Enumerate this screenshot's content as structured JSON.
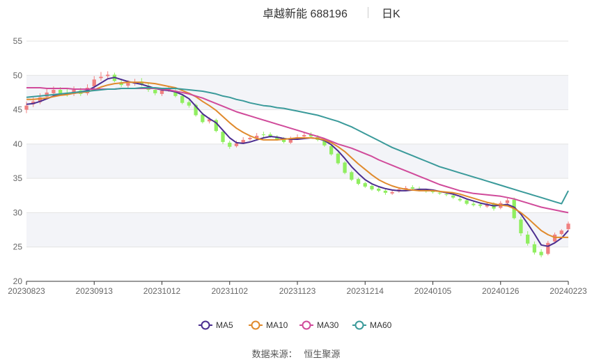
{
  "header": {
    "title": "卓越新能 688196",
    "period": "日K"
  },
  "footer": {
    "source_label": "数据来源：",
    "source_name": "恒生聚源"
  },
  "colors": {
    "up": "#f08080",
    "down": "#90ee60",
    "band": "#f3f4f8",
    "grid": "#e3e3e3",
    "axis": "#333333"
  },
  "chart_data": {
    "type": "candlestick",
    "title": "卓越新能 688196",
    "subtitle": "日K",
    "ylim": [
      20,
      55
    ],
    "yticks": [
      20,
      25,
      30,
      35,
      40,
      45,
      50,
      55
    ],
    "xticks": [
      "20230823",
      "20230913",
      "20231012",
      "20231102",
      "20231123",
      "20231214",
      "20240105",
      "20240126",
      "20240223"
    ],
    "xtick_index": [
      0,
      10,
      20,
      30,
      40,
      50,
      60,
      70,
      80
    ],
    "n_points": 81,
    "legend": [
      {
        "name": "MA5",
        "color": "#4b2d8f"
      },
      {
        "name": "MA10",
        "color": "#e08a2c"
      },
      {
        "name": "MA30",
        "color": "#d04a9a"
      },
      {
        "name": "MA60",
        "color": "#3a9a9a"
      }
    ],
    "close": [
      45.6,
      46.2,
      46.8,
      47.5,
      47.9,
      47.4,
      47.2,
      47.9,
      47.3,
      48.2,
      49.4,
      49.8,
      50.1,
      49.2,
      48.6,
      48.9,
      49.0,
      48.7,
      47.9,
      47.4,
      47.8,
      48.0,
      47.0,
      46.0,
      45.6,
      44.2,
      43.2,
      43.6,
      41.9,
      40.3,
      39.6,
      40.1,
      40.6,
      40.9,
      41.2,
      41.3,
      41.1,
      40.7,
      40.3,
      40.8,
      41.0,
      41.3,
      41.1,
      40.6,
      39.8,
      38.5,
      37.2,
      35.8,
      34.8,
      34.2,
      33.8,
      33.4,
      33.2,
      32.9,
      33.0,
      33.4,
      33.6,
      33.5,
      33.3,
      33.1,
      33.0,
      32.8,
      32.6,
      32.2,
      31.8,
      31.3,
      31.1,
      31.0,
      31.2,
      30.6,
      31.4,
      31.8,
      29.2,
      27.0,
      25.5,
      24.2,
      23.8,
      25.6,
      26.8,
      27.4,
      28.4
    ],
    "open": [
      45.0,
      45.8,
      46.1,
      46.9,
      47.4,
      47.9,
      47.5,
      47.3,
      47.8,
      47.4,
      48.4,
      49.6,
      49.9,
      50.1,
      49.0,
      48.5,
      48.8,
      49.1,
      48.5,
      47.9,
      47.3,
      47.9,
      47.8,
      47.0,
      46.1,
      45.7,
      44.3,
      43.3,
      43.5,
      41.8,
      40.2,
      39.7,
      40.2,
      40.7,
      40.8,
      41.4,
      41.4,
      41.0,
      40.8,
      40.2,
      40.9,
      41.1,
      41.4,
      41.0,
      40.6,
      39.7,
      38.6,
      37.3,
      35.9,
      34.9,
      34.3,
      33.9,
      33.5,
      33.2,
      32.8,
      33.1,
      33.4,
      33.7,
      33.5,
      33.3,
      33.2,
      32.9,
      32.7,
      32.5,
      32.0,
      31.8,
      31.3,
      31.2,
      30.9,
      31.3,
      30.7,
      31.4,
      31.9,
      29.0,
      26.8,
      25.4,
      24.3,
      24.0,
      25.8,
      26.9,
      27.6
    ],
    "high": [
      46.2,
      46.8,
      47.4,
      48.0,
      48.4,
      48.3,
      48.0,
      48.4,
      48.2,
      48.7,
      49.9,
      50.5,
      50.6,
      50.4,
      49.5,
      49.3,
      49.5,
      49.6,
      48.9,
      48.2,
      48.2,
      48.5,
      48.1,
      47.3,
      46.4,
      45.9,
      44.6,
      43.9,
      43.7,
      42.0,
      40.5,
      40.5,
      41.0,
      41.3,
      41.6,
      41.8,
      41.7,
      41.3,
      41.0,
      41.1,
      41.4,
      41.7,
      41.7,
      41.3,
      40.8,
      39.9,
      38.8,
      37.5,
      36.1,
      35.1,
      34.5,
      34.1,
      33.7,
      33.4,
      33.4,
      33.7,
      33.9,
      34.0,
      33.8,
      33.5,
      33.4,
      33.1,
      32.9,
      32.7,
      32.3,
      32.0,
      31.6,
      31.4,
      31.5,
      31.5,
      31.7,
      32.1,
      32.2,
      29.4,
      27.3,
      25.8,
      24.7,
      25.9,
      27.1,
      27.6,
      28.7
    ],
    "low": [
      44.5,
      45.4,
      45.8,
      46.5,
      47.0,
      47.1,
      46.9,
      47.0,
      47.0,
      47.1,
      48.1,
      49.2,
      49.6,
      49.0,
      48.3,
      48.2,
      48.5,
      48.4,
      47.6,
      47.1,
      47.0,
      47.6,
      46.8,
      45.8,
      45.3,
      44.0,
      43.0,
      43.0,
      41.7,
      40.0,
      39.3,
      39.5,
      40.0,
      40.5,
      40.6,
      41.0,
      40.9,
      40.5,
      40.1,
      40.0,
      40.6,
      40.9,
      40.9,
      40.4,
      39.6,
      38.3,
      37.0,
      35.6,
      34.6,
      34.0,
      33.6,
      33.2,
      33.0,
      32.6,
      32.6,
      32.9,
      33.2,
      33.3,
      33.1,
      32.9,
      32.8,
      32.6,
      32.4,
      32.0,
      31.6,
      31.1,
      30.9,
      30.7,
      30.7,
      30.3,
      30.5,
      31.2,
      29.0,
      26.6,
      25.2,
      23.9,
      23.5,
      23.8,
      25.5,
      26.7,
      27.4
    ],
    "ma5": [
      45.8,
      45.9,
      46.2,
      46.6,
      47.0,
      47.2,
      47.3,
      47.5,
      47.6,
      47.8,
      48.3,
      48.9,
      49.5,
      49.7,
      49.4,
      49.1,
      48.9,
      48.7,
      48.4,
      48.1,
      47.9,
      47.8,
      47.6,
      47.2,
      46.6,
      45.5,
      44.4,
      43.7,
      43.1,
      42.0,
      40.9,
      40.2,
      40.1,
      40.3,
      40.6,
      40.9,
      41.1,
      41.0,
      40.8,
      40.7,
      40.7,
      40.8,
      40.9,
      40.8,
      40.5,
      39.9,
      39.0,
      37.9,
      36.7,
      35.7,
      34.8,
      34.2,
      33.8,
      33.5,
      33.3,
      33.2,
      33.2,
      33.3,
      33.4,
      33.4,
      33.3,
      33.1,
      32.9,
      32.7,
      32.4,
      32.0,
      31.7,
      31.4,
      31.2,
      31.0,
      31.1,
      31.2,
      30.8,
      29.8,
      28.4,
      26.9,
      25.3,
      25.1,
      25.6,
      26.3,
      27.4
    ],
    "ma10": [
      46.5,
      46.5,
      46.6,
      46.7,
      46.9,
      47.1,
      47.2,
      47.4,
      47.5,
      47.6,
      47.9,
      48.3,
      48.6,
      48.8,
      48.9,
      49.0,
      49.0,
      49.0,
      48.9,
      48.8,
      48.6,
      48.4,
      48.2,
      47.8,
      47.4,
      46.9,
      46.2,
      45.6,
      44.9,
      44.0,
      43.1,
      42.3,
      41.7,
      41.2,
      40.8,
      40.6,
      40.6,
      40.6,
      40.7,
      40.8,
      40.9,
      40.9,
      40.9,
      40.8,
      40.6,
      40.2,
      39.6,
      38.9,
      38.0,
      37.1,
      36.3,
      35.5,
      34.8,
      34.3,
      33.9,
      33.6,
      33.4,
      33.3,
      33.2,
      33.2,
      33.2,
      33.1,
      33.0,
      32.9,
      32.7,
      32.4,
      32.1,
      31.8,
      31.5,
      31.3,
      31.1,
      31.0,
      30.6,
      30.0,
      29.2,
      28.3,
      27.4,
      26.8,
      26.4,
      26.4,
      26.4
    ],
    "ma30": [
      48.2,
      48.2,
      48.2,
      48.1,
      48.1,
      48.1,
      48.1,
      48.0,
      48.0,
      48.0,
      48.0,
      48.0,
      48.0,
      48.0,
      48.1,
      48.1,
      48.1,
      48.1,
      48.1,
      48.1,
      48.0,
      47.9,
      47.7,
      47.5,
      47.3,
      47.0,
      46.7,
      46.3,
      45.9,
      45.5,
      45.1,
      44.7,
      44.4,
      44.1,
      43.8,
      43.5,
      43.2,
      42.9,
      42.6,
      42.3,
      42.0,
      41.7,
      41.4,
      41.1,
      40.8,
      40.4,
      40.0,
      39.7,
      39.4,
      39.0,
      38.6,
      38.2,
      37.7,
      37.3,
      36.9,
      36.5,
      36.1,
      35.7,
      35.3,
      34.9,
      34.5,
      34.1,
      33.8,
      33.5,
      33.2,
      33.0,
      32.8,
      32.7,
      32.6,
      32.5,
      32.4,
      32.2,
      32.0,
      31.7,
      31.4,
      31.1,
      30.8,
      30.6,
      30.4,
      30.2,
      30.0
    ],
    "ma60": [
      46.8,
      46.9,
      47.0,
      47.1,
      47.2,
      47.3,
      47.4,
      47.5,
      47.6,
      47.7,
      47.8,
      47.9,
      48.0,
      48.0,
      48.1,
      48.1,
      48.1,
      48.2,
      48.2,
      48.2,
      48.1,
      48.1,
      48.1,
      48.0,
      47.9,
      47.8,
      47.7,
      47.5,
      47.3,
      47.0,
      46.8,
      46.5,
      46.3,
      46.0,
      45.8,
      45.6,
      45.5,
      45.3,
      45.2,
      45.0,
      44.8,
      44.6,
      44.4,
      44.2,
      43.9,
      43.6,
      43.3,
      42.9,
      42.5,
      42.0,
      41.5,
      41.0,
      40.5,
      40.0,
      39.5,
      39.1,
      38.7,
      38.3,
      37.9,
      37.5,
      37.1,
      36.7,
      36.4,
      36.1,
      35.8,
      35.5,
      35.2,
      34.9,
      34.6,
      34.3,
      34.0,
      33.7,
      33.4,
      33.1,
      32.8,
      32.5,
      32.2,
      31.9,
      31.6,
      31.3,
      33.2
    ]
  }
}
